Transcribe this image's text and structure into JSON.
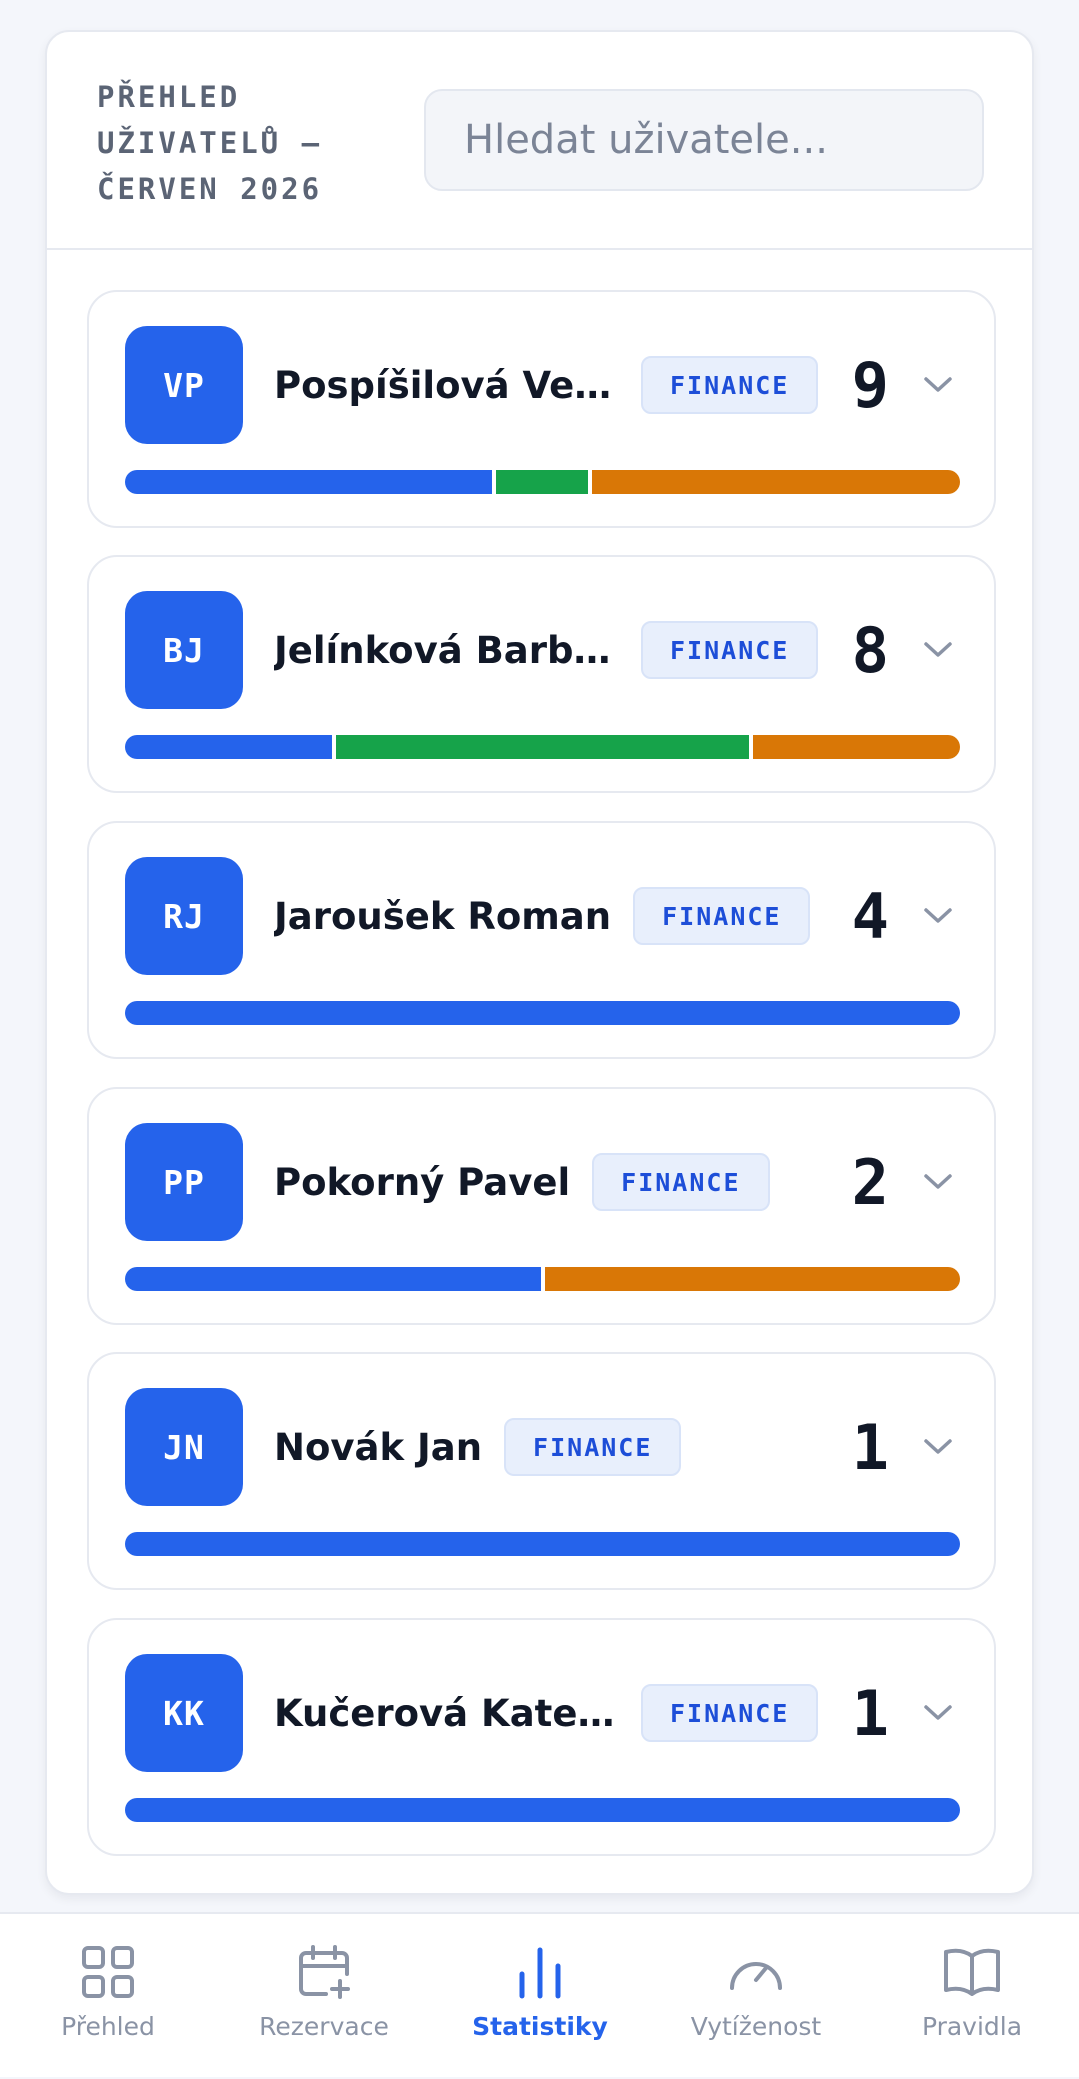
{
  "header": {
    "title_lines": [
      "PŘEHLED",
      "UŽIVATELŮ —",
      "ČERVEN 2026"
    ],
    "search_placeholder": "Hledat uživatele..."
  },
  "colors": {
    "accent": "#2563eb",
    "green": "#16a34a",
    "orange": "#d97706"
  },
  "users": [
    {
      "initials": "VP",
      "name": "Pospíšilová Vero...",
      "dept": "FINANCE",
      "count": "9",
      "segments": [
        {
          "color": "#2563eb",
          "fraction": 0.444
        },
        {
          "color": "#16a34a",
          "fraction": 0.111
        },
        {
          "color": "#d97706",
          "fraction": 0.445
        }
      ]
    },
    {
      "initials": "BJ",
      "name": "Jelínková Barbora",
      "dept": "FINANCE",
      "count": "8",
      "segments": [
        {
          "color": "#2563eb",
          "fraction": 0.25
        },
        {
          "color": "#16a34a",
          "fraction": 0.5
        },
        {
          "color": "#d97706",
          "fraction": 0.25
        }
      ]
    },
    {
      "initials": "RJ",
      "name": "Jaroušek Roman",
      "dept": "FINANCE",
      "count": "4",
      "segments": [
        {
          "color": "#2563eb",
          "fraction": 1.0
        }
      ]
    },
    {
      "initials": "PP",
      "name": "Pokorný Pavel",
      "dept": "FINANCE",
      "count": "2",
      "segments": [
        {
          "color": "#2563eb",
          "fraction": 0.5
        },
        {
          "color": "#d97706",
          "fraction": 0.5
        }
      ]
    },
    {
      "initials": "JN",
      "name": "Novák Jan",
      "dept": "FINANCE",
      "count": "1",
      "segments": [
        {
          "color": "#2563eb",
          "fraction": 1.0
        }
      ]
    },
    {
      "initials": "KK",
      "name": "Kučerová Kateřina",
      "dept": "FINANCE",
      "count": "1",
      "segments": [
        {
          "color": "#2563eb",
          "fraction": 1.0
        }
      ]
    }
  ],
  "tabs": [
    {
      "label": "Přehled",
      "icon": "grid-icon",
      "active": false
    },
    {
      "label": "Rezervace",
      "icon": "calendar-plus-icon",
      "active": false
    },
    {
      "label": "Statistiky",
      "icon": "bar-chart-icon",
      "active": true
    },
    {
      "label": "Vytíženost",
      "icon": "gauge-icon",
      "active": false
    },
    {
      "label": "Pravidla",
      "icon": "book-icon",
      "active": false
    }
  ]
}
